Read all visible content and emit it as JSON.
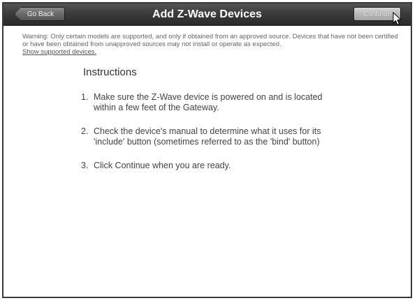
{
  "header": {
    "title": "Add Z-Wave Devices",
    "back_label": "Go Back",
    "continue_label": "Continue"
  },
  "warning": {
    "text": "Warning: Only certain models are supported, and only if obtained from an approved source. Devices that have not been certified or have been obtained from unapproved sources may not install or operate as expected.",
    "link_label": "Show supported devices."
  },
  "instructions": {
    "title": "Instructions",
    "steps": [
      {
        "num": "1.",
        "text": "Make sure the Z-Wave device is powered on and is located within a few feet of the Gateway."
      },
      {
        "num": "2.",
        "text": "Check the device's manual to determine what it uses for its 'include' button (sometimes referred to as the 'bind' button)"
      },
      {
        "num": "3.",
        "text": "Click Continue when you are ready."
      }
    ]
  },
  "icons": {
    "cursor": "mouse-pointer-icon"
  }
}
